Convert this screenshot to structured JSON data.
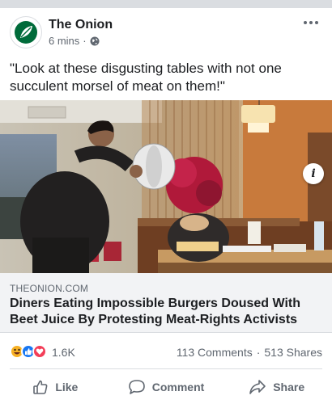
{
  "post": {
    "page_name": "The Onion",
    "time": "6 mins",
    "separator": "·",
    "privacy_icon": "globe-icon",
    "text": "\"Look at these disgusting tables with not one succulent morsel of meat on them!\""
  },
  "link": {
    "domain": "THEONION.COM",
    "title": "Diners Eating Impossible Burgers Doused With Beet Juice By Protesting Meat-Rights Activists",
    "image_icon": "info-icon"
  },
  "stats": {
    "reactions": [
      "haha",
      "like",
      "love"
    ],
    "reaction_count": "1.6K",
    "comments": "113 Comments",
    "separator": "·",
    "shares": "513 Shares"
  },
  "actions": {
    "like": "Like",
    "comment": "Comment",
    "share": "Share"
  },
  "colors": {
    "brand_green": "#006b3a",
    "like_blue": "#1877f2",
    "love_red": "#f33e58",
    "haha_yellow": "#f7b125",
    "card_bg": "#f2f3f5"
  }
}
